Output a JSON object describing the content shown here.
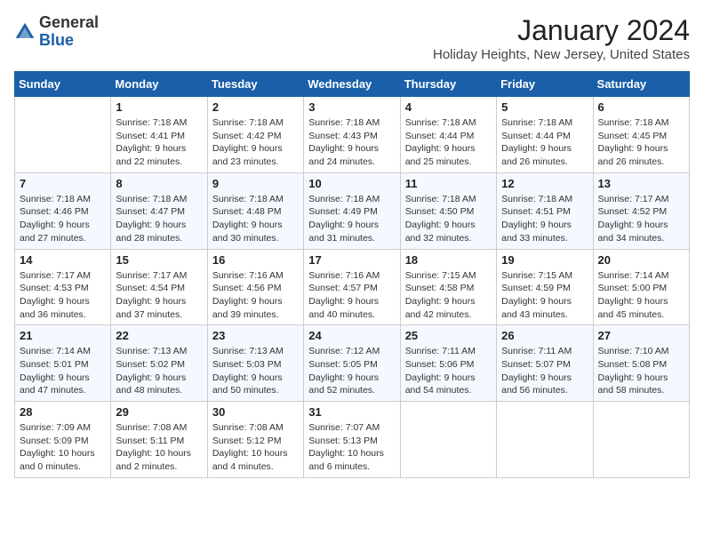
{
  "header": {
    "logo_general": "General",
    "logo_blue": "Blue",
    "month": "January 2024",
    "location": "Holiday Heights, New Jersey, United States"
  },
  "weekdays": [
    "Sunday",
    "Monday",
    "Tuesday",
    "Wednesday",
    "Thursday",
    "Friday",
    "Saturday"
  ],
  "weeks": [
    [
      {
        "day": "",
        "info": ""
      },
      {
        "day": "1",
        "info": "Sunrise: 7:18 AM\nSunset: 4:41 PM\nDaylight: 9 hours\nand 22 minutes."
      },
      {
        "day": "2",
        "info": "Sunrise: 7:18 AM\nSunset: 4:42 PM\nDaylight: 9 hours\nand 23 minutes."
      },
      {
        "day": "3",
        "info": "Sunrise: 7:18 AM\nSunset: 4:43 PM\nDaylight: 9 hours\nand 24 minutes."
      },
      {
        "day": "4",
        "info": "Sunrise: 7:18 AM\nSunset: 4:44 PM\nDaylight: 9 hours\nand 25 minutes."
      },
      {
        "day": "5",
        "info": "Sunrise: 7:18 AM\nSunset: 4:44 PM\nDaylight: 9 hours\nand 26 minutes."
      },
      {
        "day": "6",
        "info": "Sunrise: 7:18 AM\nSunset: 4:45 PM\nDaylight: 9 hours\nand 26 minutes."
      }
    ],
    [
      {
        "day": "7",
        "info": "Sunrise: 7:18 AM\nSunset: 4:46 PM\nDaylight: 9 hours\nand 27 minutes."
      },
      {
        "day": "8",
        "info": "Sunrise: 7:18 AM\nSunset: 4:47 PM\nDaylight: 9 hours\nand 28 minutes."
      },
      {
        "day": "9",
        "info": "Sunrise: 7:18 AM\nSunset: 4:48 PM\nDaylight: 9 hours\nand 30 minutes."
      },
      {
        "day": "10",
        "info": "Sunrise: 7:18 AM\nSunset: 4:49 PM\nDaylight: 9 hours\nand 31 minutes."
      },
      {
        "day": "11",
        "info": "Sunrise: 7:18 AM\nSunset: 4:50 PM\nDaylight: 9 hours\nand 32 minutes."
      },
      {
        "day": "12",
        "info": "Sunrise: 7:18 AM\nSunset: 4:51 PM\nDaylight: 9 hours\nand 33 minutes."
      },
      {
        "day": "13",
        "info": "Sunrise: 7:17 AM\nSunset: 4:52 PM\nDaylight: 9 hours\nand 34 minutes."
      }
    ],
    [
      {
        "day": "14",
        "info": "Sunrise: 7:17 AM\nSunset: 4:53 PM\nDaylight: 9 hours\nand 36 minutes."
      },
      {
        "day": "15",
        "info": "Sunrise: 7:17 AM\nSunset: 4:54 PM\nDaylight: 9 hours\nand 37 minutes."
      },
      {
        "day": "16",
        "info": "Sunrise: 7:16 AM\nSunset: 4:56 PM\nDaylight: 9 hours\nand 39 minutes."
      },
      {
        "day": "17",
        "info": "Sunrise: 7:16 AM\nSunset: 4:57 PM\nDaylight: 9 hours\nand 40 minutes."
      },
      {
        "day": "18",
        "info": "Sunrise: 7:15 AM\nSunset: 4:58 PM\nDaylight: 9 hours\nand 42 minutes."
      },
      {
        "day": "19",
        "info": "Sunrise: 7:15 AM\nSunset: 4:59 PM\nDaylight: 9 hours\nand 43 minutes."
      },
      {
        "day": "20",
        "info": "Sunrise: 7:14 AM\nSunset: 5:00 PM\nDaylight: 9 hours\nand 45 minutes."
      }
    ],
    [
      {
        "day": "21",
        "info": "Sunrise: 7:14 AM\nSunset: 5:01 PM\nDaylight: 9 hours\nand 47 minutes."
      },
      {
        "day": "22",
        "info": "Sunrise: 7:13 AM\nSunset: 5:02 PM\nDaylight: 9 hours\nand 48 minutes."
      },
      {
        "day": "23",
        "info": "Sunrise: 7:13 AM\nSunset: 5:03 PM\nDaylight: 9 hours\nand 50 minutes."
      },
      {
        "day": "24",
        "info": "Sunrise: 7:12 AM\nSunset: 5:05 PM\nDaylight: 9 hours\nand 52 minutes."
      },
      {
        "day": "25",
        "info": "Sunrise: 7:11 AM\nSunset: 5:06 PM\nDaylight: 9 hours\nand 54 minutes."
      },
      {
        "day": "26",
        "info": "Sunrise: 7:11 AM\nSunset: 5:07 PM\nDaylight: 9 hours\nand 56 minutes."
      },
      {
        "day": "27",
        "info": "Sunrise: 7:10 AM\nSunset: 5:08 PM\nDaylight: 9 hours\nand 58 minutes."
      }
    ],
    [
      {
        "day": "28",
        "info": "Sunrise: 7:09 AM\nSunset: 5:09 PM\nDaylight: 10 hours\nand 0 minutes."
      },
      {
        "day": "29",
        "info": "Sunrise: 7:08 AM\nSunset: 5:11 PM\nDaylight: 10 hours\nand 2 minutes."
      },
      {
        "day": "30",
        "info": "Sunrise: 7:08 AM\nSunset: 5:12 PM\nDaylight: 10 hours\nand 4 minutes."
      },
      {
        "day": "31",
        "info": "Sunrise: 7:07 AM\nSunset: 5:13 PM\nDaylight: 10 hours\nand 6 minutes."
      },
      {
        "day": "",
        "info": ""
      },
      {
        "day": "",
        "info": ""
      },
      {
        "day": "",
        "info": ""
      }
    ]
  ]
}
